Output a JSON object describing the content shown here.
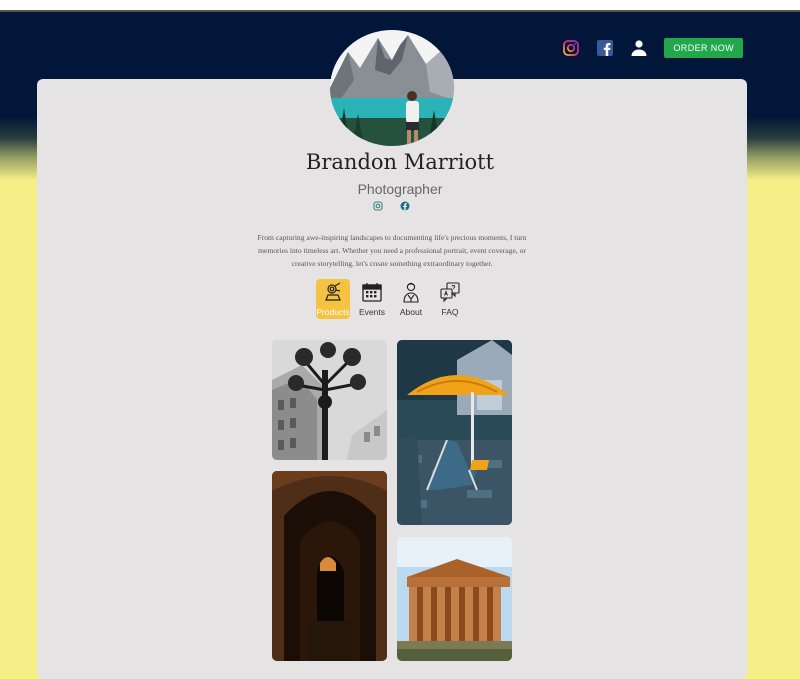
{
  "nav": {
    "order_label": "ORDER NOW",
    "icons": [
      "instagram-icon",
      "facebook-icon",
      "user-icon"
    ]
  },
  "profile": {
    "name": "Brandon Marriott",
    "role": "Photographer",
    "bio": "From capturing awe-inspiring landscapes to documenting life's precious moments, I turn memories into timeless art. Whether you need a professional portrait, event coverage, or creative storytelling, let's create something extraordinary together."
  },
  "tabs": [
    {
      "label": "Products",
      "icon": "camera-icon",
      "active": true
    },
    {
      "label": "Events",
      "icon": "calendar-icon",
      "active": false
    },
    {
      "label": "About",
      "icon": "person-icon",
      "active": false
    },
    {
      "label": "FAQ",
      "icon": "chat-icon",
      "active": false
    }
  ],
  "colors": {
    "header": "#011638",
    "page_bg": "#f6ee86",
    "card_bg": "#e6e3e4",
    "order_button": "#21a84a",
    "active_tab": "#f5c242"
  }
}
